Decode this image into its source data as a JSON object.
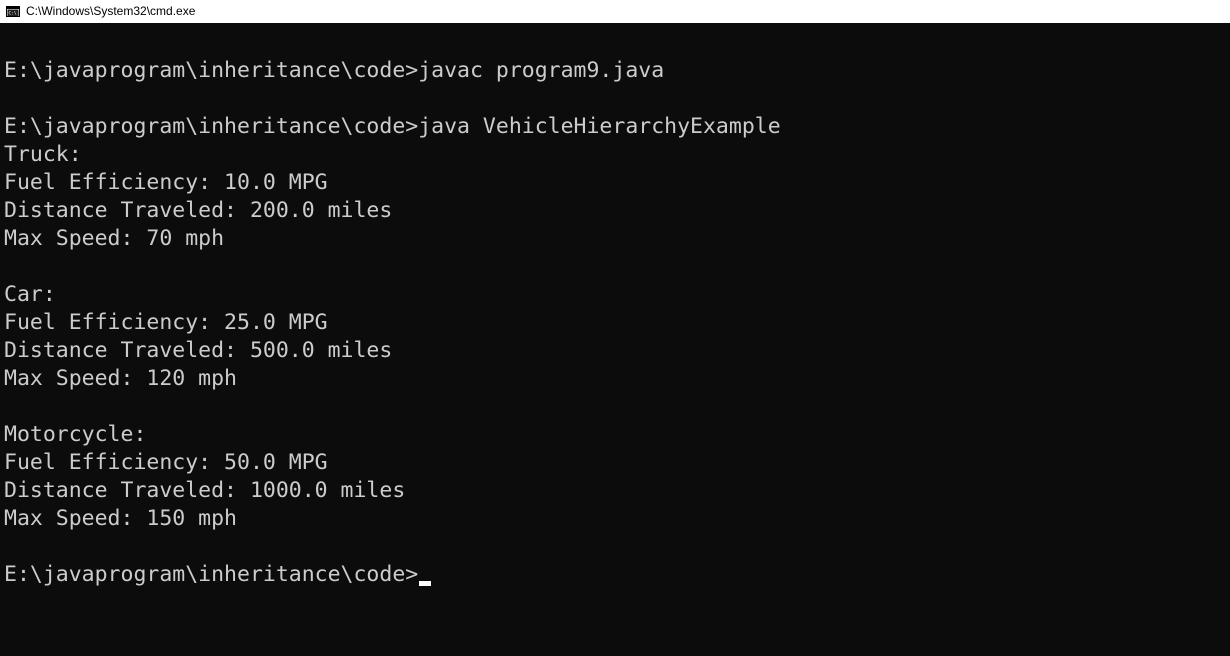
{
  "window": {
    "title": "C:\\Windows\\System32\\cmd.exe",
    "icon": "cmd-console-icon"
  },
  "console": {
    "lines": [
      "",
      "E:\\javaprogram\\inheritance\\code>javac program9.java",
      "",
      "E:\\javaprogram\\inheritance\\code>java VehicleHierarchyExample",
      "Truck:",
      "Fuel Efficiency: 10.0 MPG",
      "Distance Traveled: 200.0 miles",
      "Max Speed: 70 mph",
      "",
      "Car:",
      "Fuel Efficiency: 25.0 MPG",
      "Distance Traveled: 500.0 miles",
      "Max Speed: 120 mph",
      "",
      "Motorcycle:",
      "Fuel Efficiency: 50.0 MPG",
      "Distance Traveled: 1000.0 miles",
      "Max Speed: 150 mph",
      "",
      "E:\\javaprogram\\inheritance\\code>"
    ]
  }
}
